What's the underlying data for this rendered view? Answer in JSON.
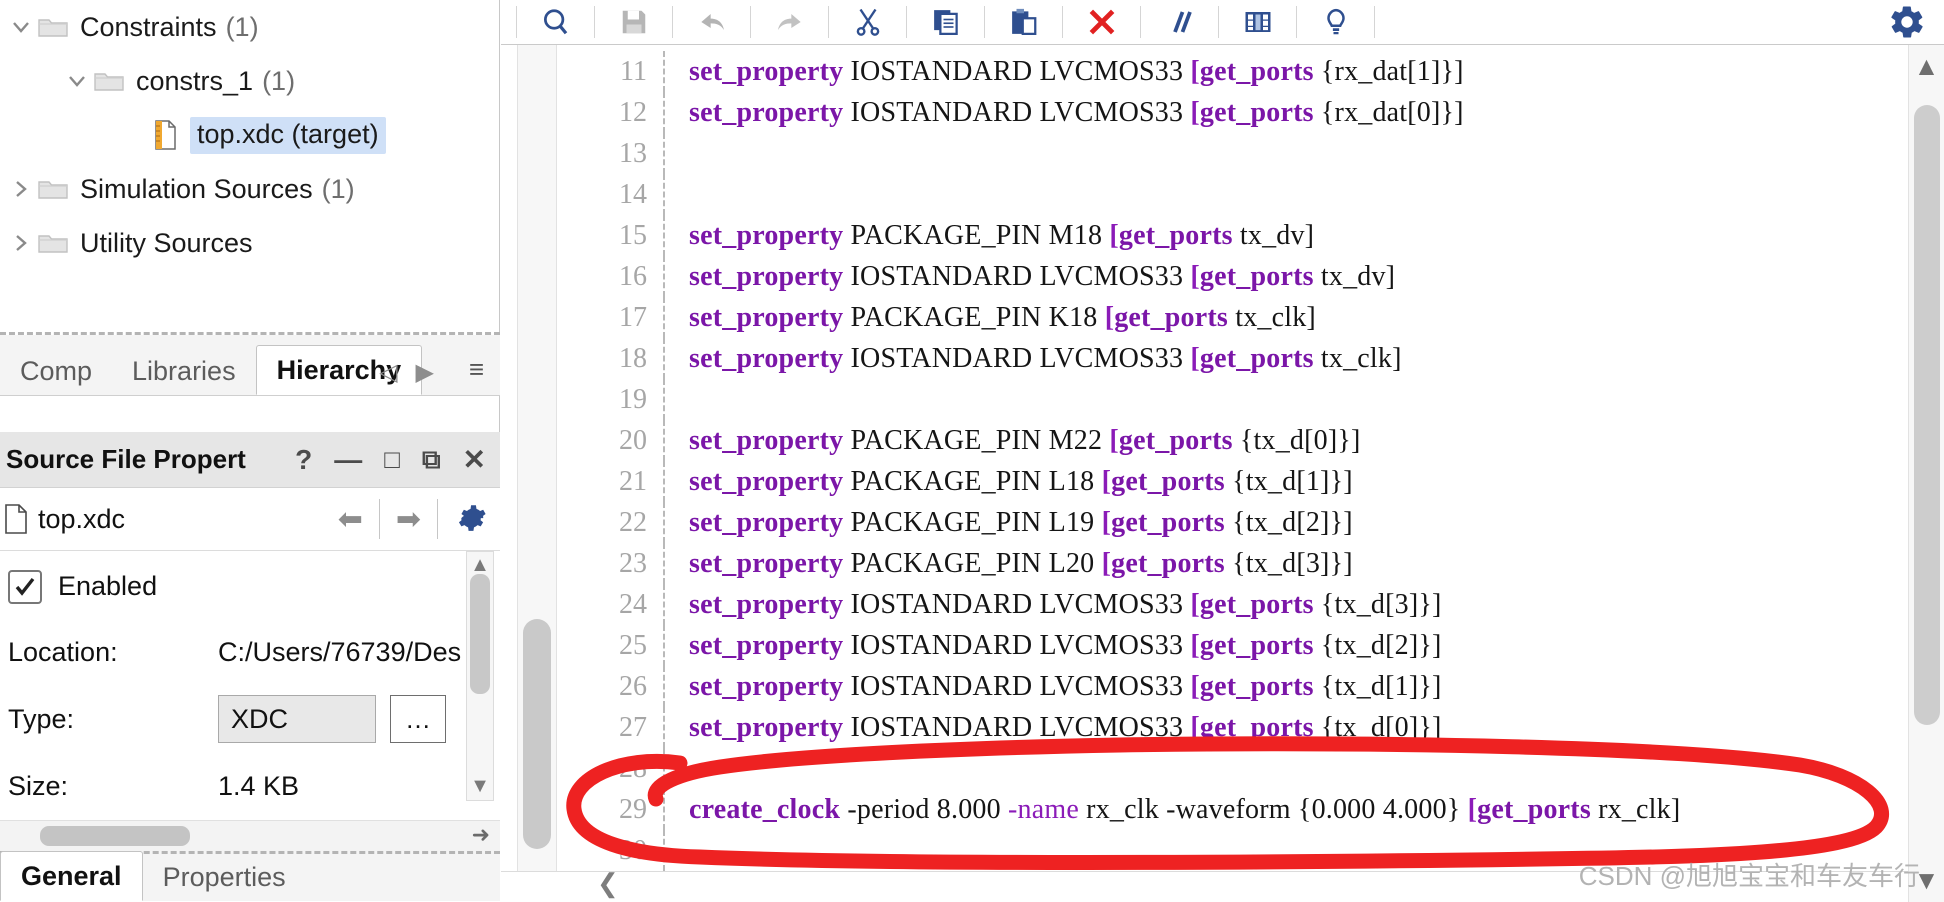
{
  "sources_tree": {
    "items": [
      {
        "twisty": "expanded",
        "icon": "folder-icon",
        "label": "Constraints",
        "count": "(1)",
        "indent": 0,
        "selected": false
      },
      {
        "twisty": "expanded",
        "icon": "folder-icon",
        "label": "constrs_1",
        "count": "(1)",
        "indent": 1,
        "selected": false
      },
      {
        "twisty": "none",
        "icon": "xdc-file-icon",
        "label": "top.xdc (target)",
        "count": "",
        "indent": 2,
        "selected": true
      },
      {
        "twisty": "collapsed",
        "icon": "folder-icon",
        "label": "Simulation Sources",
        "count": "(1)",
        "indent": 0,
        "selected": false
      },
      {
        "twisty": "collapsed",
        "icon": "folder-icon",
        "label": "Utility Sources",
        "count": "",
        "indent": 0,
        "selected": false
      }
    ]
  },
  "sources_tabs": {
    "tabs": [
      {
        "label": "Hierarchy",
        "active": true
      },
      {
        "label": "Libraries",
        "active": false
      },
      {
        "label": "Comp",
        "active": false
      }
    ],
    "prev_arrow": "◁",
    "next_arrow": "▶",
    "menu_icon": "≡"
  },
  "properties_panel": {
    "title": "Source File Propert",
    "window_buttons": [
      "?",
      "—",
      "□",
      "⧉",
      "✕"
    ],
    "file_name": "top.xdc",
    "file_icon": "file-icon",
    "back_arrow": "⬅",
    "forward_arrow": "➡",
    "gear_icon": "gear-icon",
    "enabled_label": "Enabled",
    "enabled_checked": true,
    "rows": [
      {
        "label": "Location:",
        "value": "C:/Users/76739/Des"
      },
      {
        "label": "Type:",
        "value": "XDC",
        "has_browse": true,
        "browse_label": "…"
      },
      {
        "label": "Size:",
        "value": "1.4 KB"
      }
    ],
    "bottom_tabs": [
      {
        "label": "General",
        "active": true
      },
      {
        "label": "Properties",
        "active": false
      }
    ]
  },
  "toolbar": {
    "buttons": [
      {
        "name": "find-icon",
        "title": "Find"
      },
      {
        "name": "save-icon",
        "title": "Save File"
      },
      {
        "name": "undo-icon",
        "title": "Undo"
      },
      {
        "name": "redo-icon",
        "title": "Redo"
      },
      {
        "name": "cut-icon",
        "title": "Cut"
      },
      {
        "name": "copy-icon",
        "title": "Copy"
      },
      {
        "name": "paste-icon",
        "title": "Paste"
      },
      {
        "name": "delete-icon",
        "title": "Delete"
      },
      {
        "name": "comment-icon",
        "title": "Toggle Comment"
      },
      {
        "name": "columns-icon",
        "title": "Column Select"
      },
      {
        "name": "bulb-icon",
        "title": "Hints"
      }
    ],
    "settings_icon": "gear-icon"
  },
  "editor": {
    "lines": [
      {
        "num": "11",
        "tokens": [
          {
            "t": "set_property ",
            "c": "kw2"
          },
          {
            "t": "IOSTANDARD LVCMOS33 ",
            "c": "tk"
          },
          {
            "t": "[",
            "c": "brk"
          },
          {
            "t": "get_ports ",
            "c": "kw2"
          },
          {
            "t": "{rx_dat[1]}]",
            "c": "tk"
          }
        ]
      },
      {
        "num": "12",
        "tokens": [
          {
            "t": "set_property ",
            "c": "kw2"
          },
          {
            "t": "IOSTANDARD LVCMOS33 ",
            "c": "tk"
          },
          {
            "t": "[",
            "c": "brk"
          },
          {
            "t": "get_ports ",
            "c": "kw2"
          },
          {
            "t": "{rx_dat[0]}]",
            "c": "tk"
          }
        ]
      },
      {
        "num": "13",
        "tokens": []
      },
      {
        "num": "14",
        "tokens": []
      },
      {
        "num": "15",
        "tokens": [
          {
            "t": "set_property ",
            "c": "kw2"
          },
          {
            "t": "PACKAGE_PIN M18 ",
            "c": "tk"
          },
          {
            "t": "[",
            "c": "brk"
          },
          {
            "t": "get_ports ",
            "c": "kw2"
          },
          {
            "t": "tx_dv]",
            "c": "tk"
          }
        ]
      },
      {
        "num": "16",
        "tokens": [
          {
            "t": "set_property ",
            "c": "kw2"
          },
          {
            "t": "IOSTANDARD LVCMOS33 ",
            "c": "tk"
          },
          {
            "t": "[",
            "c": "brk"
          },
          {
            "t": "get_ports ",
            "c": "kw2"
          },
          {
            "t": "tx_dv]",
            "c": "tk"
          }
        ]
      },
      {
        "num": "17",
        "tokens": [
          {
            "t": "set_property ",
            "c": "kw2"
          },
          {
            "t": "PACKAGE_PIN K18 ",
            "c": "tk"
          },
          {
            "t": "[",
            "c": "brk"
          },
          {
            "t": "get_ports ",
            "c": "kw2"
          },
          {
            "t": "tx_clk]",
            "c": "tk"
          }
        ]
      },
      {
        "num": "18",
        "tokens": [
          {
            "t": "set_property ",
            "c": "kw2"
          },
          {
            "t": "IOSTANDARD LVCMOS33 ",
            "c": "tk"
          },
          {
            "t": "[",
            "c": "brk"
          },
          {
            "t": "get_ports ",
            "c": "kw2"
          },
          {
            "t": "tx_clk]",
            "c": "tk"
          }
        ]
      },
      {
        "num": "19",
        "tokens": []
      },
      {
        "num": "20",
        "tokens": [
          {
            "t": "set_property ",
            "c": "kw2"
          },
          {
            "t": "PACKAGE_PIN M22 ",
            "c": "tk"
          },
          {
            "t": "[",
            "c": "brk"
          },
          {
            "t": "get_ports ",
            "c": "kw2"
          },
          {
            "t": "{tx_d[0]}]",
            "c": "tk"
          }
        ]
      },
      {
        "num": "21",
        "tokens": [
          {
            "t": "set_property ",
            "c": "kw2"
          },
          {
            "t": "PACKAGE_PIN L18 ",
            "c": "tk"
          },
          {
            "t": "[",
            "c": "brk"
          },
          {
            "t": "get_ports ",
            "c": "kw2"
          },
          {
            "t": "{tx_d[1]}]",
            "c": "tk"
          }
        ]
      },
      {
        "num": "22",
        "tokens": [
          {
            "t": "set_property ",
            "c": "kw2"
          },
          {
            "t": "PACKAGE_PIN L19 ",
            "c": "tk"
          },
          {
            "t": "[",
            "c": "brk"
          },
          {
            "t": "get_ports ",
            "c": "kw2"
          },
          {
            "t": "{tx_d[2]}]",
            "c": "tk"
          }
        ]
      },
      {
        "num": "23",
        "tokens": [
          {
            "t": "set_property ",
            "c": "kw2"
          },
          {
            "t": "PACKAGE_PIN L20 ",
            "c": "tk"
          },
          {
            "t": "[",
            "c": "brk"
          },
          {
            "t": "get_ports ",
            "c": "kw2"
          },
          {
            "t": "{tx_d[3]}]",
            "c": "tk"
          }
        ]
      },
      {
        "num": "24",
        "tokens": [
          {
            "t": "set_property ",
            "c": "kw2"
          },
          {
            "t": "IOSTANDARD LVCMOS33 ",
            "c": "tk"
          },
          {
            "t": "[",
            "c": "brk"
          },
          {
            "t": "get_ports ",
            "c": "kw2"
          },
          {
            "t": "{tx_d[3]}]",
            "c": "tk"
          }
        ]
      },
      {
        "num": "25",
        "tokens": [
          {
            "t": "set_property ",
            "c": "kw2"
          },
          {
            "t": "IOSTANDARD LVCMOS33 ",
            "c": "tk"
          },
          {
            "t": "[",
            "c": "brk"
          },
          {
            "t": "get_ports ",
            "c": "kw2"
          },
          {
            "t": "{tx_d[2]}]",
            "c": "tk"
          }
        ]
      },
      {
        "num": "26",
        "tokens": [
          {
            "t": "set_property ",
            "c": "kw2"
          },
          {
            "t": "IOSTANDARD LVCMOS33 ",
            "c": "tk"
          },
          {
            "t": "[",
            "c": "brk"
          },
          {
            "t": "get_ports ",
            "c": "kw2"
          },
          {
            "t": "{tx_d[1]}]",
            "c": "tk"
          }
        ]
      },
      {
        "num": "27",
        "tokens": [
          {
            "t": "set_property ",
            "c": "kw2"
          },
          {
            "t": "IOSTANDARD LVCMOS33 ",
            "c": "tk"
          },
          {
            "t": "[",
            "c": "brk"
          },
          {
            "t": "get_ports ",
            "c": "kw2"
          },
          {
            "t": "{tx_d[0]}]",
            "c": "tk"
          }
        ]
      },
      {
        "num": "28",
        "tokens": []
      },
      {
        "num": "29",
        "tokens": [
          {
            "t": "create_clock ",
            "c": "kw2"
          },
          {
            "t": "-period 8.000 ",
            "c": "tk"
          },
          {
            "t": "-name",
            "c": "kw"
          },
          {
            "t": " rx_clk -waveform {0.000 4.000} ",
            "c": "tk"
          },
          {
            "t": "[",
            "c": "brk"
          },
          {
            "t": "get_ports ",
            "c": "kw2"
          },
          {
            "t": "rx_clk]",
            "c": "tk"
          }
        ]
      },
      {
        "num": "30",
        "tokens": []
      }
    ],
    "scroll_up_arrow": "⌃",
    "scroll_down_arrow": "⌄"
  },
  "annotation": {
    "type": "red-ink-circle",
    "color": "#ee2222",
    "target_line": "29"
  },
  "watermark": {
    "text": "CSDN @旭旭宝宝和车友车行"
  },
  "colors": {
    "keyword": "#8b1bb8",
    "selection": "#cfe0f7",
    "toolbar_blue": "#2f4f8f",
    "delete_red": "#e12121",
    "annotation_red": "#ee2222"
  }
}
